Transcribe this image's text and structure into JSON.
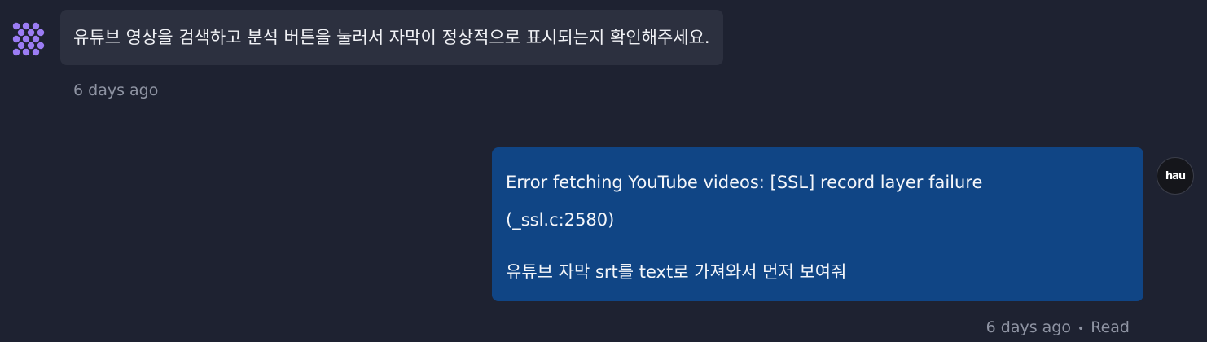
{
  "messages": [
    {
      "role": "assistant",
      "avatar_icon": "dots-logo-icon",
      "text": "유튜브 영상을 검색하고 분석 버튼을 눌러서 자막이 정상적으로 표시되는지 확인해주세요.",
      "time": "6 days ago"
    },
    {
      "role": "user",
      "lines": [
        "Error fetching YouTube videos: [SSL] record layer failure",
        "(_ssl.c:2580)",
        "유튜브 자막 srt를 text로 가져와서 먼저 보여줘"
      ],
      "avatar_text": "hau",
      "time": "6 days ago",
      "status_separator": "•",
      "status": "Read"
    }
  ],
  "colors": {
    "background": "#1e2231",
    "assistant_bubble": "#2c303f",
    "user_bubble": "#104585",
    "meta_text": "#8f94a3",
    "logo": "#9b7cf4"
  }
}
